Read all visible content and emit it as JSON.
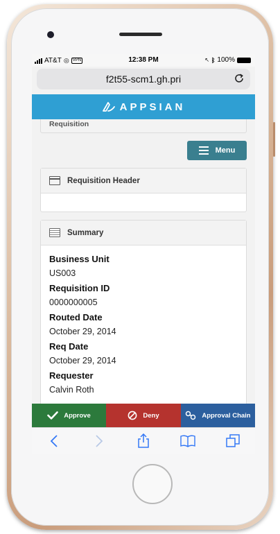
{
  "status_bar": {
    "carrier": "AT&T",
    "vpn": "VPN",
    "time": "12:38 PM",
    "battery": "100%"
  },
  "browser": {
    "url": "f2t55-scm1.gh.pri"
  },
  "brand": {
    "name": "APPSIAN",
    "color": "#2f9fd3"
  },
  "page": {
    "section_title": "Requisition",
    "menu_label": "Menu",
    "panels": {
      "requisition_header": "Requisition Header",
      "summary": "Summary"
    },
    "summary_fields": [
      {
        "label": "Business Unit",
        "value": "US003"
      },
      {
        "label": "Requisition ID",
        "value": "0000000005"
      },
      {
        "label": "Routed Date",
        "value": "October 29, 2014"
      },
      {
        "label": "Req Date",
        "value": "October 29, 2014"
      },
      {
        "label": "Requester",
        "value": "Calvin Roth"
      }
    ]
  },
  "actions": {
    "approve": "Approve",
    "deny": "Deny",
    "approval_chain": "Approval Chain"
  },
  "colors": {
    "approve": "#2c7a3c",
    "deny": "#b5332e",
    "approval_chain": "#2c5f9e",
    "menu": "#3a7f8f"
  }
}
